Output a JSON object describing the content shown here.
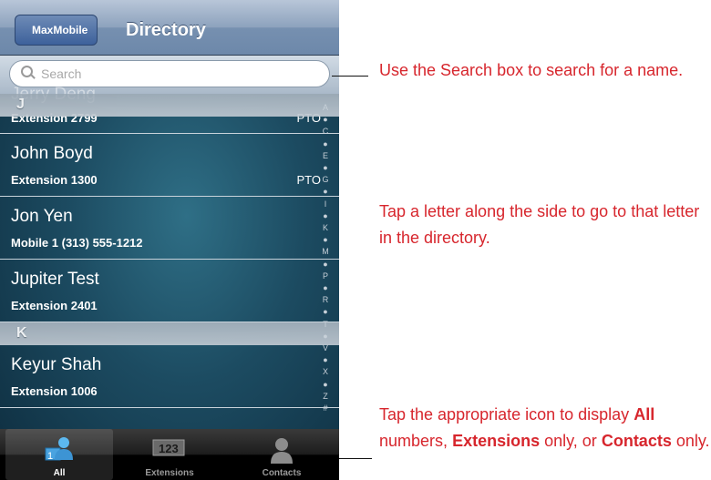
{
  "nav": {
    "back_label": "MaxMobile",
    "title": "Directory"
  },
  "search": {
    "placeholder": "Search",
    "icon": "search-icon"
  },
  "sections": [
    {
      "letter": "J",
      "rows": [
        {
          "name": "Jerry Deng",
          "detail": "Extension 2799",
          "status": "PTO"
        },
        {
          "name": "John Boyd",
          "detail": "Extension 1300",
          "status": "PTO"
        },
        {
          "name": "Jon Yen",
          "detail": "Mobile 1 (313) 555-1212",
          "status": ""
        },
        {
          "name": "Jupiter Test",
          "detail": "Extension 2401",
          "status": ""
        }
      ]
    },
    {
      "letter": "K",
      "rows": [
        {
          "name": "Keyur Shah",
          "detail": "Extension 1006",
          "status": ""
        }
      ]
    }
  ],
  "index": [
    "A",
    "●",
    "C",
    "●",
    "E",
    "●",
    "G",
    "●",
    "I",
    "●",
    "K",
    "●",
    "M",
    "●",
    "P",
    "●",
    "R",
    "●",
    "T",
    "●",
    "V",
    "●",
    "X",
    "●",
    "Z",
    "#"
  ],
  "tabs": [
    {
      "label": "All",
      "icon": "all-contacts-icon",
      "active": true
    },
    {
      "label": "Extensions",
      "icon": "extensions-icon",
      "active": false
    },
    {
      "label": "Contacts",
      "icon": "contacts-person-icon",
      "active": false
    }
  ],
  "annotations": {
    "search": {
      "text": "Use the Search box to search for a name."
    },
    "index": {
      "text": "Tap a letter along the side to go to that letter in the directory."
    },
    "tabs": {
      "prefix": "Tap the appropriate icon to display",
      "all": "All",
      "mid1": "numbers,",
      "ext": "Extensions",
      "mid2": "only, or",
      "contacts": "Contacts",
      "suffix": "only."
    }
  },
  "colors": {
    "annotation": "#d7262d",
    "nav_tint": "#7690b0"
  }
}
